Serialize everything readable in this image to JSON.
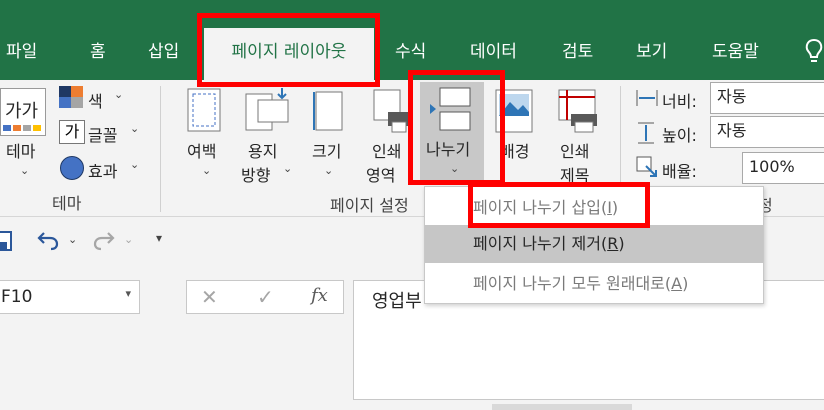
{
  "tabs": [
    "파일",
    "홈",
    "삽입",
    "페이지 레이아웃",
    "수식",
    "데이터",
    "검토",
    "보기",
    "도움말"
  ],
  "ribbon": {
    "theme": {
      "colors": "색",
      "fonts": "글꼴",
      "effects": "효과",
      "themes_l1": "테마",
      "theme_preview": "가가",
      "group": "테마",
      "font_icon_char": "가"
    },
    "page_setup": {
      "margins_l1": "여백",
      "orientation_l1": "용지",
      "orientation_l2": "방향",
      "size_l1": "크기",
      "print_area_l1": "인쇄",
      "print_area_l2": "영역",
      "breaks_l1": "나누기",
      "background_l1": "배경",
      "print_titles_l1": "인쇄",
      "print_titles_l2": "제목",
      "group": "페이지 설정"
    },
    "scale": {
      "width_label": "너비:",
      "width_value": "자동",
      "height_label": "높이:",
      "height_value": "자동",
      "scale_label": "배율:",
      "scale_value": "100%",
      "group_tail": "정"
    }
  },
  "breaks_menu": {
    "items": [
      {
        "label": "페이지 나누기 삽입",
        "key": "I"
      },
      {
        "label": "페이지 나누기 제거",
        "key": "R"
      },
      {
        "label": "페이지 나누기 모두 원래대로",
        "key": "A"
      }
    ]
  },
  "formula_bar": {
    "name_box": "F10",
    "content": "영업부",
    "fx": "fx"
  },
  "colors": {
    "excel_green": "#217346",
    "highlight": "#ff0000"
  }
}
